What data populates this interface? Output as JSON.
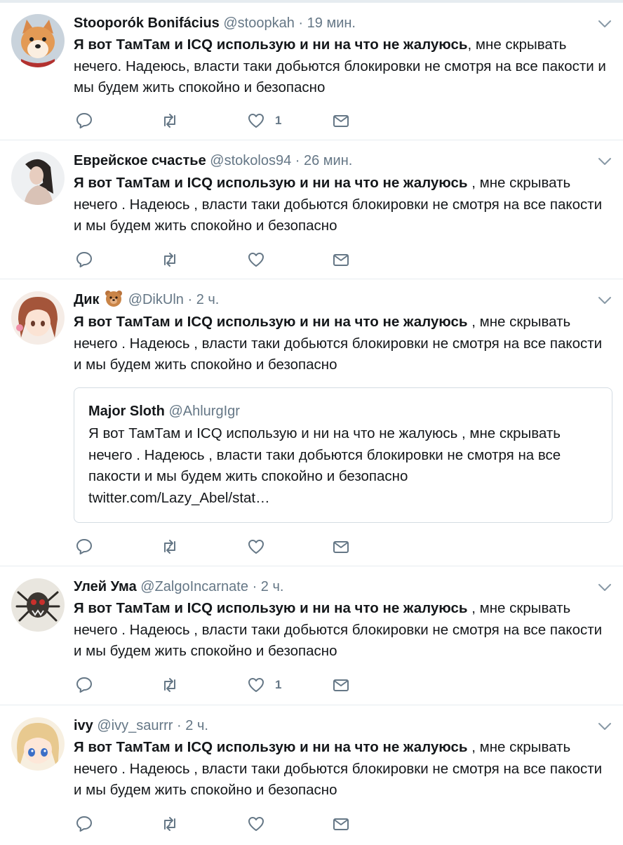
{
  "tweets": [
    {
      "name": "Stooporók Bonifácius",
      "handle": "@stoopkah",
      "dot": "·",
      "time": "19 мин.",
      "avatar": "shiba-dog-avatar",
      "text_bold": "Я вот ТамТам и ICQ использую и ни на что не жалуюсь",
      "text_rest": ", мне скрывать нечего. Надеюсь, власти таки добьются блокировки не смотря на все пакости и мы будем жить спокойно и безопасно",
      "like_count": "1"
    },
    {
      "name": "Еврейское счастье",
      "handle": "@stokolos94",
      "dot": "·",
      "time": "26 мин.",
      "avatar": "woman-photo-avatar",
      "text_bold": "Я вот ТамТам и ICQ использую и ни на что не жалуюсь",
      "text_rest": " , мне скрывать нечего . Надеюсь , власти таки добьются блокировки не смотря на все пакости и мы будем жить спокойно и безопасно",
      "like_count": ""
    },
    {
      "name": "Дик",
      "name_emoji": "bear-face-emoji",
      "handle": "@DikUln",
      "dot": "·",
      "time": "2 ч.",
      "avatar": "anime-girl-avatar",
      "text_bold": "Я вот ТамТам и ICQ использую и ни на что не жалуюсь",
      "text_rest": " , мне скрывать нечего . Надеюсь , власти таки добьются блокировки не смотря на все пакости и мы будем жить спокойно и безопасно",
      "like_count": "",
      "quote": {
        "name": "Major Sloth",
        "handle": "@AhlurgIgr",
        "text": "Я вот ТамТам и ICQ использую и ни на что не жалуюсь , мне скрывать нечего . Надеюсь , власти таки добьются блокировки не смотря на все пакости и мы будем жить спокойно и безопасно",
        "link": "twitter.com/Lazy_Abel/stat…"
      }
    },
    {
      "name": "Улей Ума",
      "handle": "@ZalgoIncarnate",
      "dot": "·",
      "time": "2 ч.",
      "avatar": "spider-creature-avatar",
      "text_bold": "Я вот ТамТам и ICQ использую и ни на что не жалуюсь",
      "text_rest": " , мне скрывать нечего . Надеюсь , власти таки добьются блокировки не смотря на все пакости и мы будем жить спокойно и безопасно",
      "like_count": "1"
    },
    {
      "name": "ivy",
      "handle": "@ivy_saurrr",
      "dot": "·",
      "time": "2 ч.",
      "avatar": "anime-blonde-avatar",
      "text_bold": "Я вот ТамТам и ICQ использую и ни на что не жалуюсь",
      "text_rest": " , мне скрывать нечего . Надеюсь , власти таки добьются блокировки не смотря на все пакости и мы будем жить спокойно и безопасно",
      "like_count": ""
    }
  ],
  "icons": {
    "reply": "reply-icon",
    "retweet": "retweet-icon",
    "like": "heart-icon",
    "dm": "envelope-icon",
    "menu": "chevron-down-icon"
  },
  "colors": {
    "secondary_text": "#657786",
    "icon": "#657786",
    "divider": "#e6ecf0"
  }
}
